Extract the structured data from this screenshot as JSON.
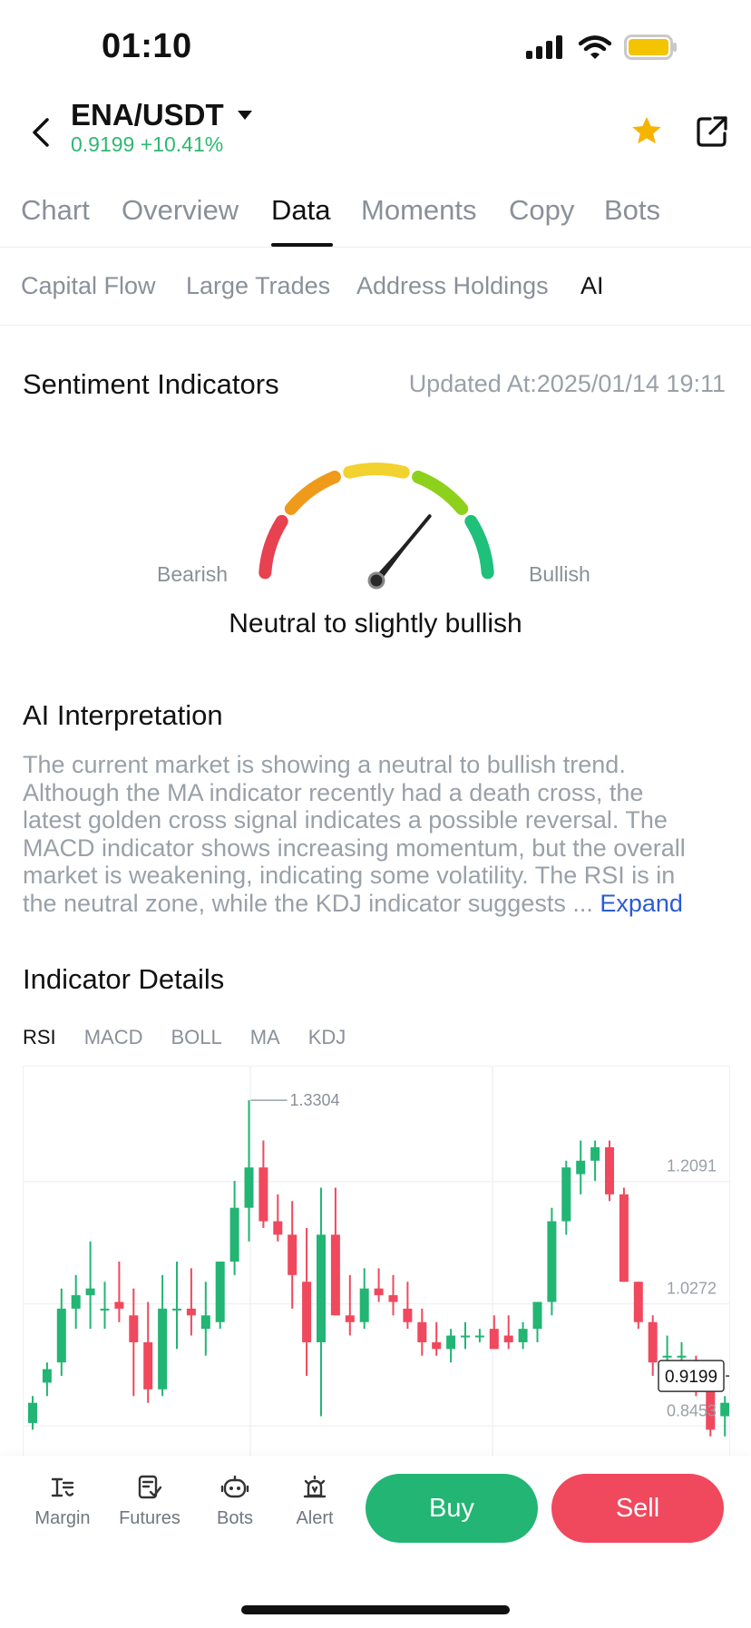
{
  "status_bar": {
    "time": "01:10",
    "battery_color": "#f5c400"
  },
  "header": {
    "pair": "ENA/USDT",
    "price": "0.9199",
    "change": "+10.41%",
    "price_color": "#2eb873",
    "star_color": "#f5b400"
  },
  "tabs": [
    {
      "label": "Chart",
      "active": false
    },
    {
      "label": "Overview",
      "active": false
    },
    {
      "label": "Data",
      "active": true
    },
    {
      "label": "Moments",
      "active": false
    },
    {
      "label": "Copy",
      "active": false
    },
    {
      "label": "Bots",
      "active": false
    }
  ],
  "subtabs": [
    {
      "label": "Capital Flow",
      "active": false
    },
    {
      "label": "Large Trades",
      "active": false
    },
    {
      "label": "Address Holdings",
      "active": false
    },
    {
      "label": "AI",
      "active": true
    }
  ],
  "sentiment": {
    "title": "Sentiment Indicators",
    "updated": "Updated At:2025/01/14 19:11",
    "bearish_label": "Bearish",
    "bullish_label": "Bullish",
    "verdict": "Neutral to slightly bullish",
    "level": 0.72,
    "segment_colors": [
      "#e8414f",
      "#ef9a1a",
      "#f2d22e",
      "#8ed11c",
      "#1fc07a"
    ]
  },
  "ai": {
    "title": "AI Interpretation",
    "lines": [
      "The current market is showing a neutral to bullish trend.",
      "Although the MA indicator recently had a death cross, the",
      "latest golden cross signal indicates a possible reversal. The",
      "MACD indicator shows increasing momentum, but the overall",
      "market is weakening, indicating some volatility. The RSI is in",
      "the neutral zone, while the KDJ indicator suggests ... "
    ],
    "expand": "Expand"
  },
  "indicators": {
    "title": "Indicator Details",
    "tabs": [
      {
        "label": "RSI",
        "active": true
      },
      {
        "label": "MACD",
        "active": false
      },
      {
        "label": "BOLL",
        "active": false
      },
      {
        "label": "MA",
        "active": false
      },
      {
        "label": "KDJ",
        "active": false
      }
    ]
  },
  "chart_data": {
    "type": "candlestick",
    "y_ticks": [
      "1.2091",
      "1.0272",
      "0.8453"
    ],
    "high_label": "1.3304",
    "last_price": "0.9199",
    "up_color": "#22b574",
    "down_color": "#f0485d",
    "ylim": [
      0.8,
      1.38
    ],
    "candles": [
      {
        "o": 0.85,
        "h": 0.89,
        "l": 0.84,
        "c": 0.88
      },
      {
        "o": 0.91,
        "h": 0.94,
        "l": 0.89,
        "c": 0.93
      },
      {
        "o": 0.94,
        "h": 1.05,
        "l": 0.92,
        "c": 1.02
      },
      {
        "o": 1.02,
        "h": 1.07,
        "l": 0.99,
        "c": 1.04
      },
      {
        "o": 1.04,
        "h": 1.12,
        "l": 0.99,
        "c": 1.05
      },
      {
        "o": 1.02,
        "h": 1.06,
        "l": 0.99,
        "c": 1.02
      },
      {
        "o": 1.03,
        "h": 1.09,
        "l": 1.0,
        "c": 1.02
      },
      {
        "o": 1.01,
        "h": 1.05,
        "l": 0.89,
        "c": 0.97
      },
      {
        "o": 0.97,
        "h": 1.03,
        "l": 0.88,
        "c": 0.9
      },
      {
        "o": 0.9,
        "h": 1.07,
        "l": 0.89,
        "c": 1.02
      },
      {
        "o": 1.02,
        "h": 1.09,
        "l": 0.96,
        "c": 1.02
      },
      {
        "o": 1.02,
        "h": 1.08,
        "l": 0.98,
        "c": 1.01
      },
      {
        "o": 0.99,
        "h": 1.06,
        "l": 0.95,
        "c": 1.01
      },
      {
        "o": 1.0,
        "h": 1.09,
        "l": 0.99,
        "c": 1.09
      },
      {
        "o": 1.09,
        "h": 1.21,
        "l": 1.07,
        "c": 1.17
      },
      {
        "o": 1.17,
        "h": 1.33,
        "l": 1.12,
        "c": 1.23
      },
      {
        "o": 1.23,
        "h": 1.27,
        "l": 1.14,
        "c": 1.15
      },
      {
        "o": 1.15,
        "h": 1.19,
        "l": 1.12,
        "c": 1.13
      },
      {
        "o": 1.13,
        "h": 1.18,
        "l": 1.02,
        "c": 1.07
      },
      {
        "o": 1.06,
        "h": 1.14,
        "l": 0.92,
        "c": 0.97
      },
      {
        "o": 0.97,
        "h": 1.2,
        "l": 0.86,
        "c": 1.13
      },
      {
        "o": 1.13,
        "h": 1.2,
        "l": 1.01,
        "c": 1.01
      },
      {
        "o": 1.01,
        "h": 1.07,
        "l": 0.98,
        "c": 1.0
      },
      {
        "o": 1.0,
        "h": 1.08,
        "l": 0.99,
        "c": 1.05
      },
      {
        "o": 1.05,
        "h": 1.08,
        "l": 1.03,
        "c": 1.04
      },
      {
        "o": 1.04,
        "h": 1.07,
        "l": 1.01,
        "c": 1.03
      },
      {
        "o": 1.02,
        "h": 1.06,
        "l": 0.99,
        "c": 1.0
      },
      {
        "o": 1.0,
        "h": 1.02,
        "l": 0.95,
        "c": 0.97
      },
      {
        "o": 0.97,
        "h": 1.0,
        "l": 0.95,
        "c": 0.96
      },
      {
        "o": 0.96,
        "h": 0.99,
        "l": 0.94,
        "c": 0.98
      },
      {
        "o": 0.98,
        "h": 1.0,
        "l": 0.96,
        "c": 0.98
      },
      {
        "o": 0.98,
        "h": 0.99,
        "l": 0.97,
        "c": 0.98
      },
      {
        "o": 0.99,
        "h": 1.01,
        "l": 0.96,
        "c": 0.96
      },
      {
        "o": 0.98,
        "h": 1.01,
        "l": 0.96,
        "c": 0.97
      },
      {
        "o": 0.97,
        "h": 1.0,
        "l": 0.96,
        "c": 0.99
      },
      {
        "o": 0.99,
        "h": 1.03,
        "l": 0.97,
        "c": 1.03
      },
      {
        "o": 1.03,
        "h": 1.17,
        "l": 1.01,
        "c": 1.15
      },
      {
        "o": 1.15,
        "h": 1.24,
        "l": 1.13,
        "c": 1.23
      },
      {
        "o": 1.22,
        "h": 1.27,
        "l": 1.19,
        "c": 1.24
      },
      {
        "o": 1.24,
        "h": 1.27,
        "l": 1.21,
        "c": 1.26
      },
      {
        "o": 1.26,
        "h": 1.27,
        "l": 1.18,
        "c": 1.19
      },
      {
        "o": 1.19,
        "h": 1.2,
        "l": 1.06,
        "c": 1.06
      },
      {
        "o": 1.06,
        "h": 1.06,
        "l": 0.99,
        "c": 1.0
      },
      {
        "o": 1.0,
        "h": 1.01,
        "l": 0.92,
        "c": 0.94
      },
      {
        "o": 0.95,
        "h": 0.98,
        "l": 0.91,
        "c": 0.95
      },
      {
        "o": 0.95,
        "h": 0.97,
        "l": 0.93,
        "c": 0.95
      },
      {
        "o": 0.94,
        "h": 0.95,
        "l": 0.89,
        "c": 0.93
      },
      {
        "o": 0.92,
        "h": 0.93,
        "l": 0.83,
        "c": 0.84
      },
      {
        "o": 0.86,
        "h": 0.89,
        "l": 0.83,
        "c": 0.88
      },
      {
        "o": 0.88,
        "h": 0.93,
        "l": 0.82,
        "c": 0.92
      }
    ]
  },
  "bottom_nav": [
    {
      "label": "Margin",
      "icon": "margin-icon"
    },
    {
      "label": "Futures",
      "icon": "futures-icon"
    },
    {
      "label": "Bots",
      "icon": "bots-icon"
    },
    {
      "label": "Alert",
      "icon": "alert-icon"
    }
  ],
  "actions": {
    "buy": "Buy",
    "sell": "Sell"
  }
}
